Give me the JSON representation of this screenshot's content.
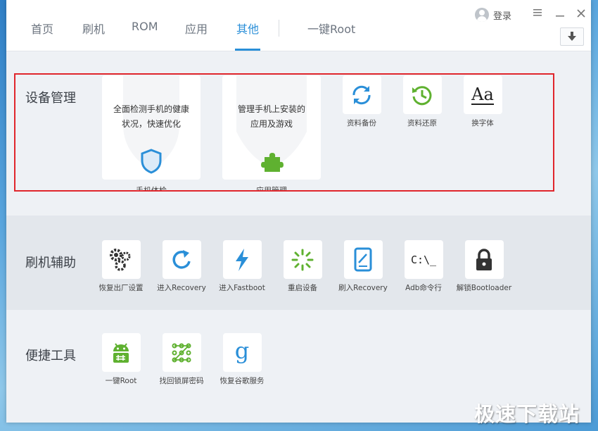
{
  "nav": {
    "tabs": [
      "首页",
      "刷机",
      "ROM",
      "应用",
      "其他"
    ],
    "active_tab": "其他",
    "root_link": "一键Root"
  },
  "header": {
    "login_label": "登录",
    "menu_icon": "hamburger-icon",
    "minimize_icon": "minimize-icon",
    "close_icon": "close-icon",
    "download_icon": "download-arrow-icon"
  },
  "sections": {
    "device": {
      "title": "设备管理",
      "cards": [
        {
          "desc_line1": "全面检测手机的健康",
          "desc_line2": "状况，快速优化",
          "caption": "手机体检",
          "icon": "shield-icon"
        },
        {
          "desc_line1": "管理手机上安装的",
          "desc_line2": "应用及游戏",
          "caption": "应用管理",
          "icon": "puzzle-icon"
        }
      ],
      "tools": [
        {
          "label": "资料备份",
          "icon": "sync-icon"
        },
        {
          "label": "资料还原",
          "icon": "history-icon"
        },
        {
          "label": "换字体",
          "icon": "font-icon",
          "glyph": "Aa"
        }
      ]
    },
    "flash": {
      "title": "刷机辅助",
      "tools": [
        {
          "label": "恢复出厂设置",
          "icon": "gears-icon"
        },
        {
          "label": "进入Recovery",
          "icon": "refresh-icon"
        },
        {
          "label": "进入Fastboot",
          "icon": "lightning-icon"
        },
        {
          "label": "重启设备",
          "icon": "spinner-icon"
        },
        {
          "label": "刷入Recovery",
          "icon": "tablet-icon"
        },
        {
          "label": "Adb命令行",
          "icon": "terminal-icon",
          "glyph": "C:\\_"
        },
        {
          "label": "解锁Bootloader",
          "icon": "lock-icon"
        }
      ]
    },
    "quick": {
      "title": "便捷工具",
      "tools": [
        {
          "label": "一键Root",
          "icon": "android-icon"
        },
        {
          "label": "找回锁屏密码",
          "icon": "pattern-lock-icon"
        },
        {
          "label": "恢复谷歌服务",
          "icon": "google-g-icon",
          "glyph": "g"
        }
      ]
    }
  },
  "colors": {
    "accent": "#2a8fd8",
    "highlight_border": "#e0262c",
    "green": "#5fb130"
  },
  "watermark": "极速下载站"
}
